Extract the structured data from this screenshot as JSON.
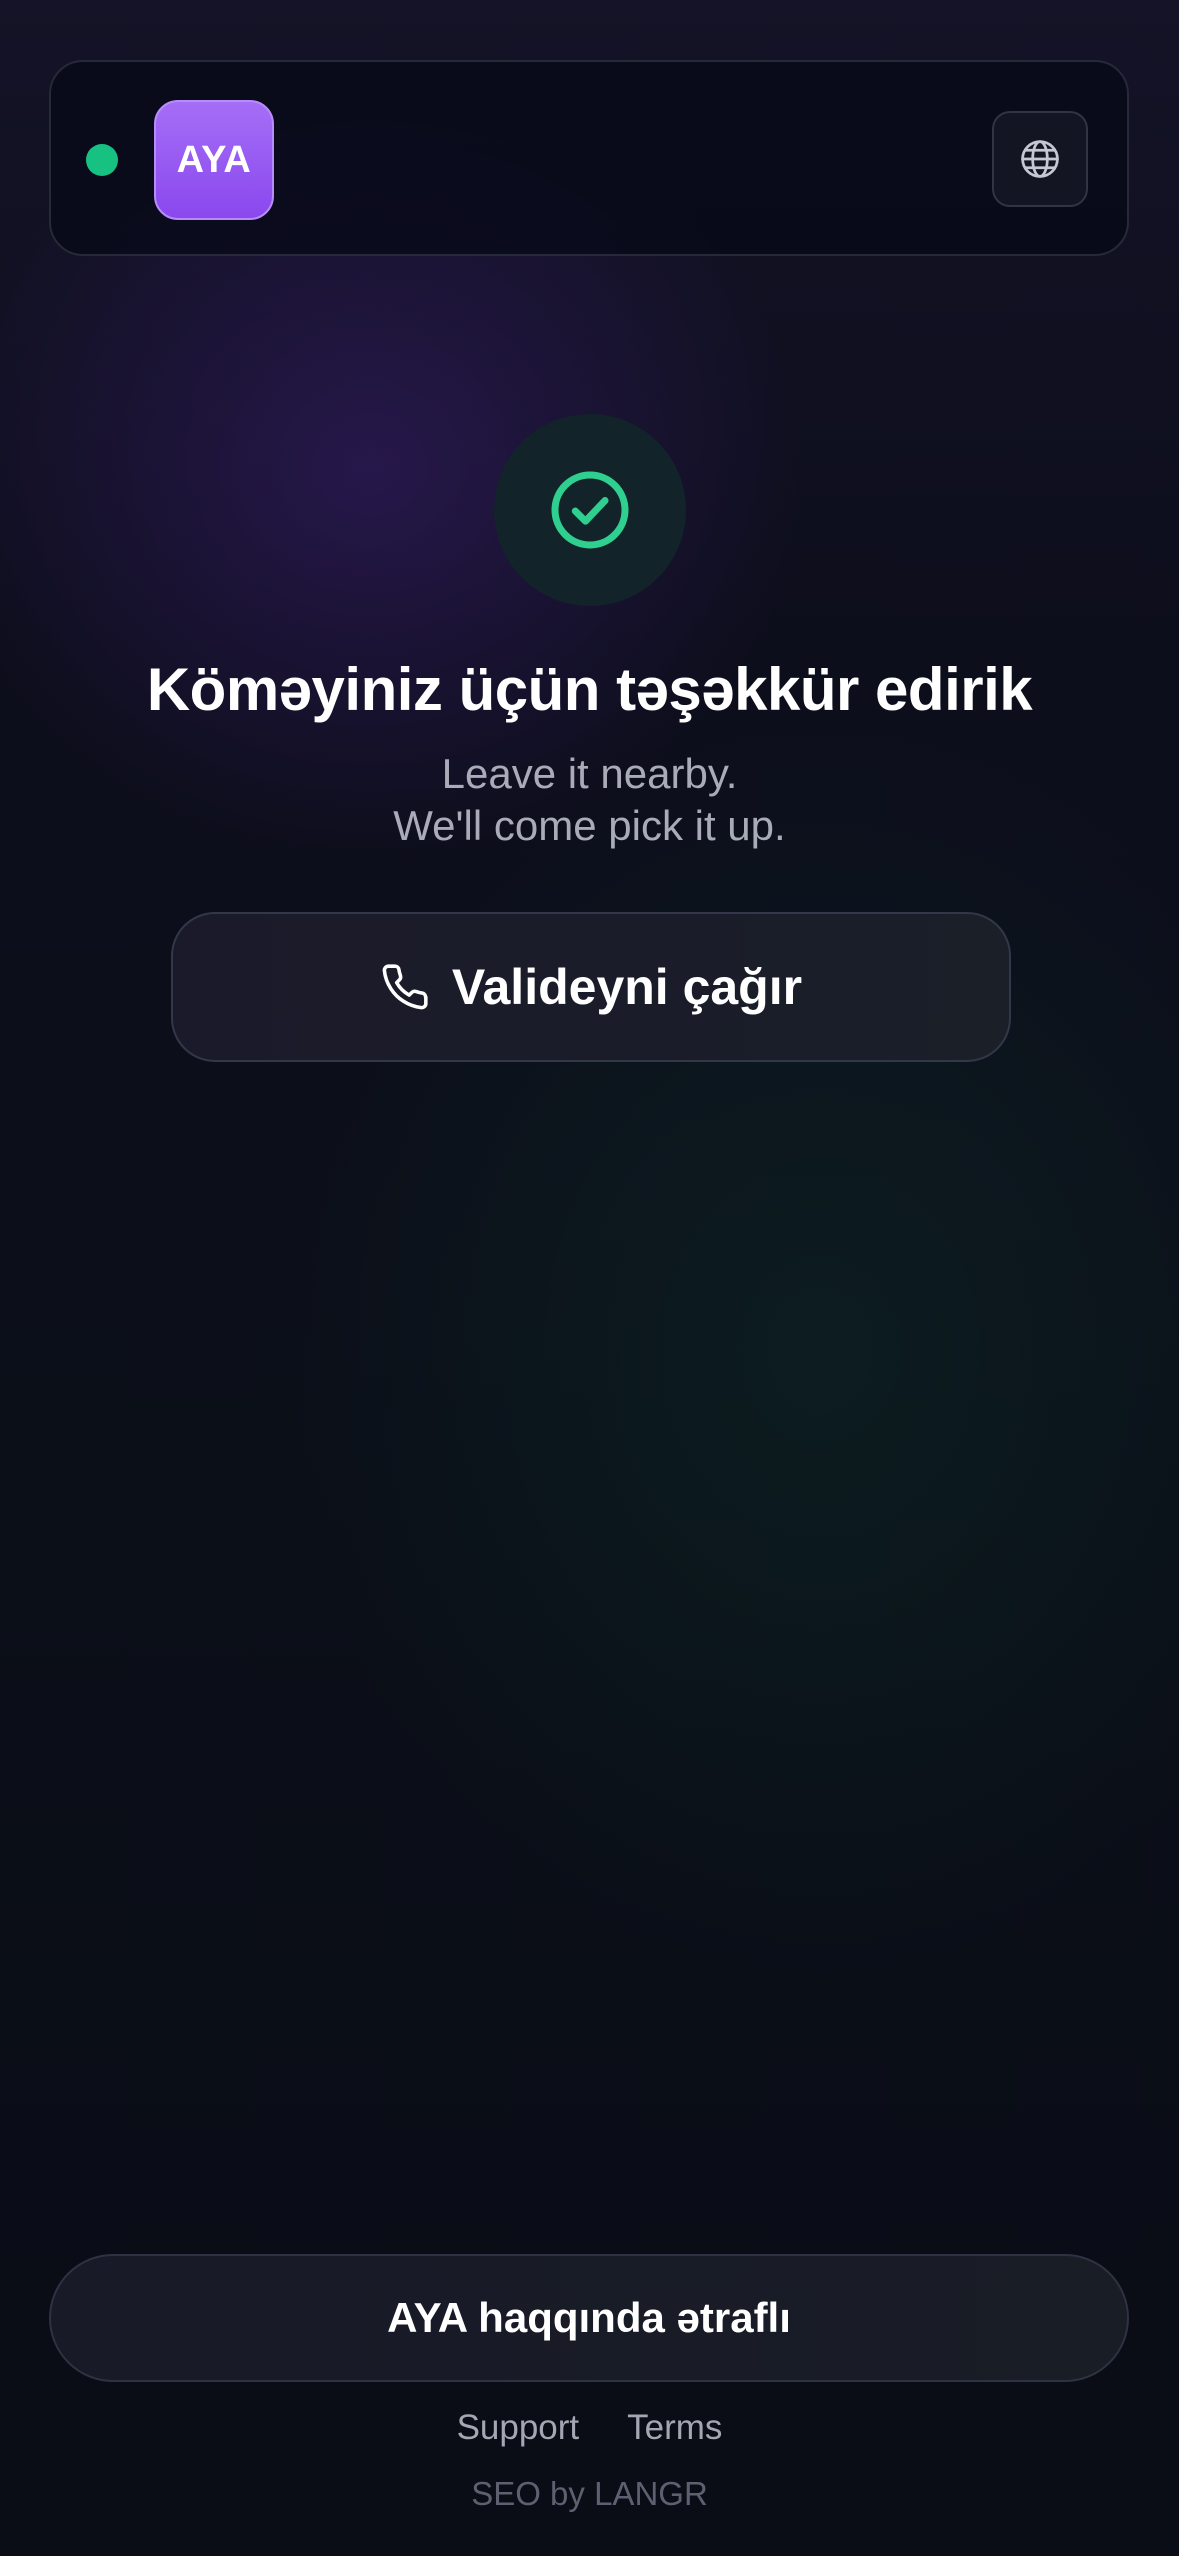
{
  "header": {
    "status": "online",
    "logo_text": "AYA",
    "language_icon": "globe-icon",
    "accent_color": "#8b4cee",
    "status_color": "#16c182"
  },
  "main": {
    "success_icon": "check-circle-icon",
    "title": "Köməyiniz üçün təşəkkür edirik",
    "subtitle_lines": [
      "Leave it nearby.",
      "We'll come pick it up."
    ],
    "call_button": {
      "icon": "phone-icon",
      "label": "Validеyni çağır"
    }
  },
  "footer": {
    "about_label": "AYA haqqında ətraflı",
    "links": [
      {
        "label": "Support"
      },
      {
        "label": "Terms"
      }
    ],
    "credit": "SEO by LANGR"
  }
}
